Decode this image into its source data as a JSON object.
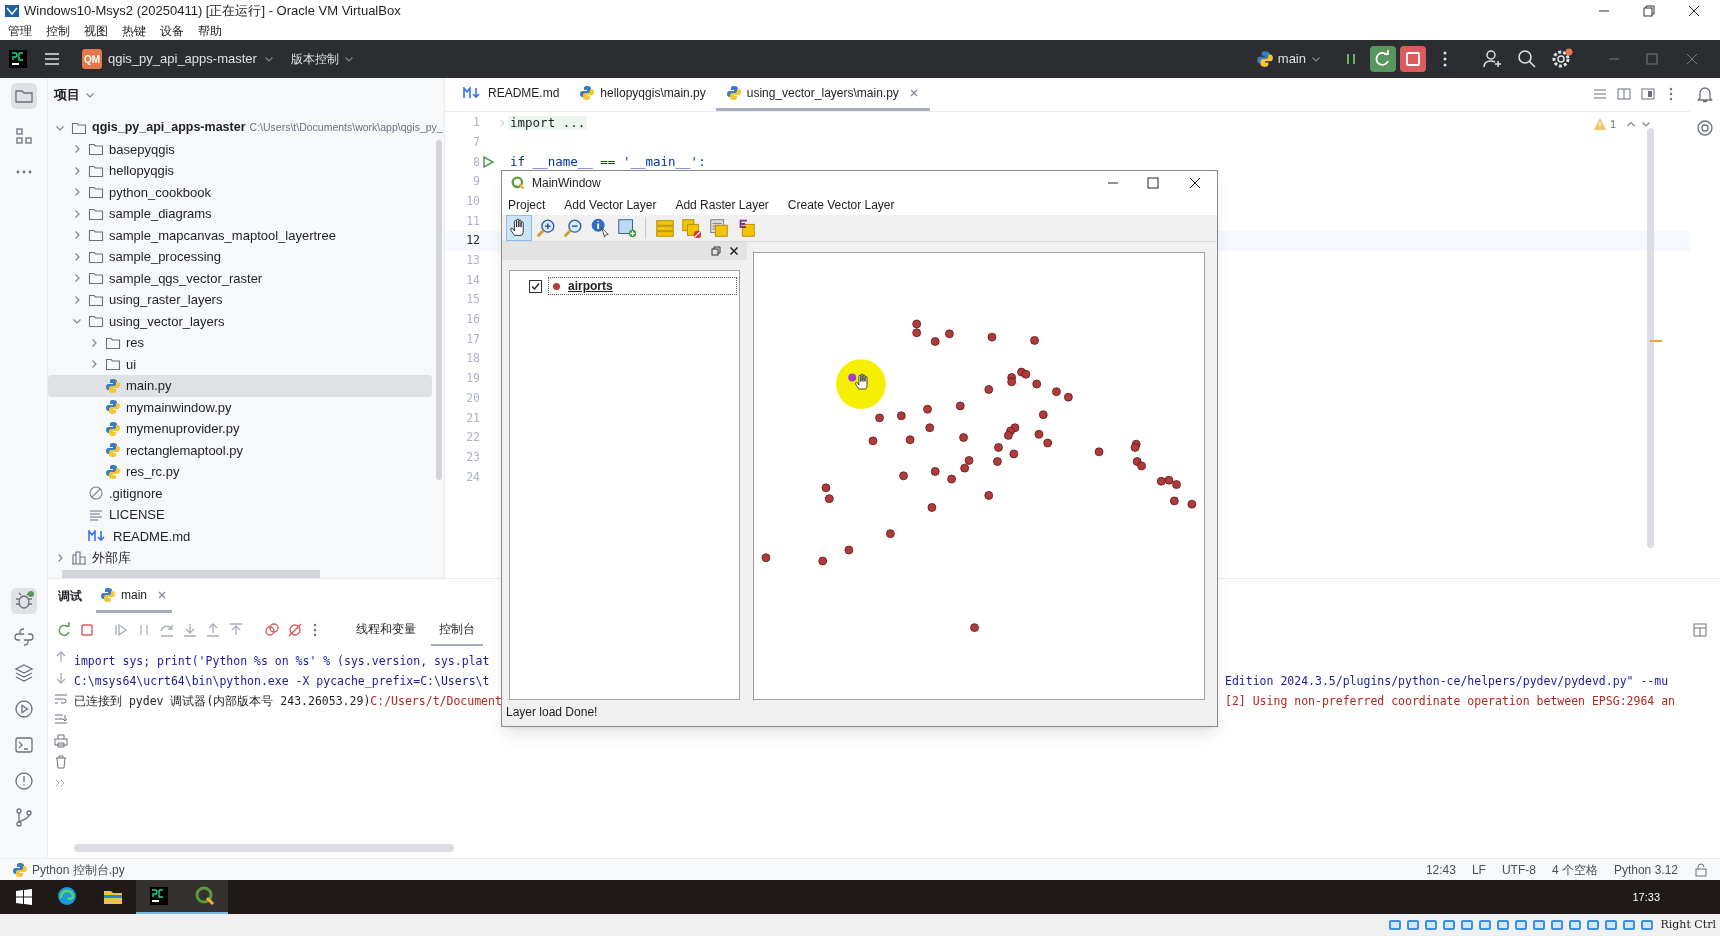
{
  "vm_window": {
    "title": "Windows10-Msys2 (20250411) [正在运行] - Oracle VM VirtualBox",
    "menu": [
      "管理",
      "控制",
      "视图",
      "热键",
      "设备",
      "帮助"
    ]
  },
  "ide_toolbar": {
    "project_badge": "QM",
    "project": "qgis_py_api_apps-master",
    "vcs": "版本控制",
    "branch": "main"
  },
  "project_panel": {
    "title": "项目",
    "tree": [
      {
        "name": "qgis_py_api_apps-master",
        "path": "C:\\Users\\t\\Documents\\work\\app\\qgis_py_",
        "kind": "folder",
        "expanded": true,
        "selected": false,
        "children": [
          {
            "name": "basepyqgis",
            "kind": "folder",
            "expanded": false,
            "selected": false
          },
          {
            "name": "hellopyqgis",
            "kind": "folder",
            "expanded": false,
            "selected": false
          },
          {
            "name": "python_cookbook",
            "kind": "folder",
            "expanded": false,
            "selected": false
          },
          {
            "name": "sample_diagrams",
            "kind": "folder",
            "expanded": false,
            "selected": false
          },
          {
            "name": "sample_mapcanvas_maptool_layertree",
            "kind": "folder",
            "expanded": false,
            "selected": false
          },
          {
            "name": "sample_processing",
            "kind": "folder",
            "expanded": false,
            "selected": false
          },
          {
            "name": "sample_qgs_vector_raster",
            "kind": "folder",
            "expanded": false,
            "selected": false
          },
          {
            "name": "using_raster_layers",
            "kind": "folder",
            "expanded": false,
            "selected": false
          },
          {
            "name": "using_vector_layers",
            "kind": "folder",
            "expanded": true,
            "selected": false,
            "children": [
              {
                "name": "res",
                "kind": "folder",
                "expanded": false,
                "selected": false
              },
              {
                "name": "ui",
                "kind": "folder",
                "expanded": false,
                "selected": false
              },
              {
                "name": "main.py",
                "kind": "python",
                "selected": true
              },
              {
                "name": "mymainwindow.py",
                "kind": "python",
                "selected": false
              },
              {
                "name": "mymenuprovider.py",
                "kind": "python",
                "selected": false
              },
              {
                "name": "rectanglemaptool.py",
                "kind": "python",
                "selected": false
              },
              {
                "name": "res_rc.py",
                "kind": "python",
                "selected": false
              }
            ]
          },
          {
            "name": ".gitignore",
            "kind": "ignore",
            "selected": false
          },
          {
            "name": "LICENSE",
            "kind": "text",
            "selected": false
          },
          {
            "name": "README.md",
            "kind": "markdown",
            "selected": false
          }
        ]
      },
      {
        "name": "外部库",
        "kind": "library",
        "expanded": false,
        "selected": false
      }
    ]
  },
  "editor_tabs": [
    {
      "label": "README.md",
      "kind": "markdown",
      "selected": false
    },
    {
      "label": "hellopyqgis\\main.py",
      "kind": "python",
      "selected": false
    },
    {
      "label": "using_vector_layers\\main.py",
      "kind": "python",
      "selected": true
    }
  ],
  "editor": {
    "warning_count": "1",
    "lines": [
      {
        "number": "1",
        "code": "import ...",
        "folded": true,
        "current": false,
        "run": false
      },
      {
        "number": "7",
        "current": false,
        "run": false
      },
      {
        "number": "8",
        "code": "if __name__ == '__main__':",
        "folded": false,
        "current": false,
        "run": true
      },
      {
        "number": "9",
        "current": false,
        "run": false
      },
      {
        "number": "10",
        "current": false,
        "run": false
      },
      {
        "number": "11",
        "current": false,
        "run": false
      },
      {
        "number": "12",
        "current": true,
        "run": false
      },
      {
        "number": "13",
        "current": false,
        "run": false
      },
      {
        "number": "14",
        "current": false,
        "run": false
      },
      {
        "number": "15",
        "current": false,
        "run": false
      },
      {
        "number": "16",
        "current": false,
        "run": false
      },
      {
        "number": "17",
        "current": false,
        "run": false
      },
      {
        "number": "18",
        "current": false,
        "run": false
      },
      {
        "number": "19",
        "current": false,
        "run": false
      },
      {
        "number": "20",
        "current": false,
        "run": false
      },
      {
        "number": "21",
        "current": false,
        "run": false
      },
      {
        "number": "22",
        "current": false,
        "run": false
      },
      {
        "number": "23",
        "current": false,
        "run": false
      },
      {
        "number": "24",
        "current": false,
        "run": false
      }
    ]
  },
  "qgis_window": {
    "title": "MainWindow",
    "menu": [
      "Project",
      "Add Vector Layer",
      "Add Raster Layer",
      "Create Vector Layer"
    ],
    "tool_groups": [
      [
        {
          "kind": "pan",
          "selected": true
        },
        {
          "kind": "zoom_in",
          "selected": false
        },
        {
          "kind": "zoom_out",
          "selected": false
        },
        {
          "kind": "identify",
          "selected": false
        },
        {
          "kind": "add_rect",
          "selected": false
        }
      ],
      [
        {
          "kind": "layer_stack",
          "selected": false
        },
        {
          "kind": "remove_layer",
          "selected": false
        },
        {
          "kind": "layer_list",
          "selected": false
        },
        {
          "kind": "expression",
          "selected": false
        }
      ]
    ],
    "layers": [
      {
        "name": "airports",
        "checked": true,
        "selected": true,
        "color": "#b33a3a"
      }
    ],
    "status": "Layer load Done!"
  },
  "debug_panel": {
    "title": "调试",
    "tabs": [
      {
        "label": "main",
        "selected": true
      }
    ],
    "views": [
      {
        "label": "线程和变量",
        "selected": false
      },
      {
        "label": "控制台",
        "selected": true
      }
    ],
    "console": [
      {
        "left": [
          {
            "text": "import sys; print('Python %s on %s' % (sys.version, sys.plat",
            "kind": "command"
          }
        ]
      },
      {
        "left": [
          {
            "text": "C:\\msys64\\ucrt64\\bin\\python.exe -X pycache_prefix=C:\\Users\\t",
            "kind": "command"
          }
        ],
        "right": [
          {
            "text": "Edition 2024.3.5/plugins/python-ce/helpers/pydev/pydevd.py\" --mu",
            "kind": "command"
          }
        ]
      },
      {
        "left": [
          {
            "text": "已连接到 pydev 调试器(内部版本号 243.26053.29)",
            "kind": "info"
          },
          {
            "text": "C:/Users/t/Document",
            "kind": "error"
          }
        ],
        "right": [
          {
            "text": "[2] Using non-preferred coordinate operation between EPSG:2964 an",
            "kind": "error"
          }
        ]
      }
    ]
  },
  "status_bar": {
    "file": "Python 控制台.py",
    "items": [
      "12:43",
      "LF",
      "UTF-8",
      "4 个空格",
      "Python 3.12"
    ]
  },
  "taskbar": {
    "apps": [
      {
        "kind": "edge",
        "active": false
      },
      {
        "kind": "explorer",
        "active": false
      },
      {
        "kind": "pycharm",
        "active": true
      },
      {
        "kind": "qgis",
        "active": true
      }
    ],
    "time": "17:33"
  },
  "vm_status": {
    "host_key": "Right Ctrl"
  }
}
